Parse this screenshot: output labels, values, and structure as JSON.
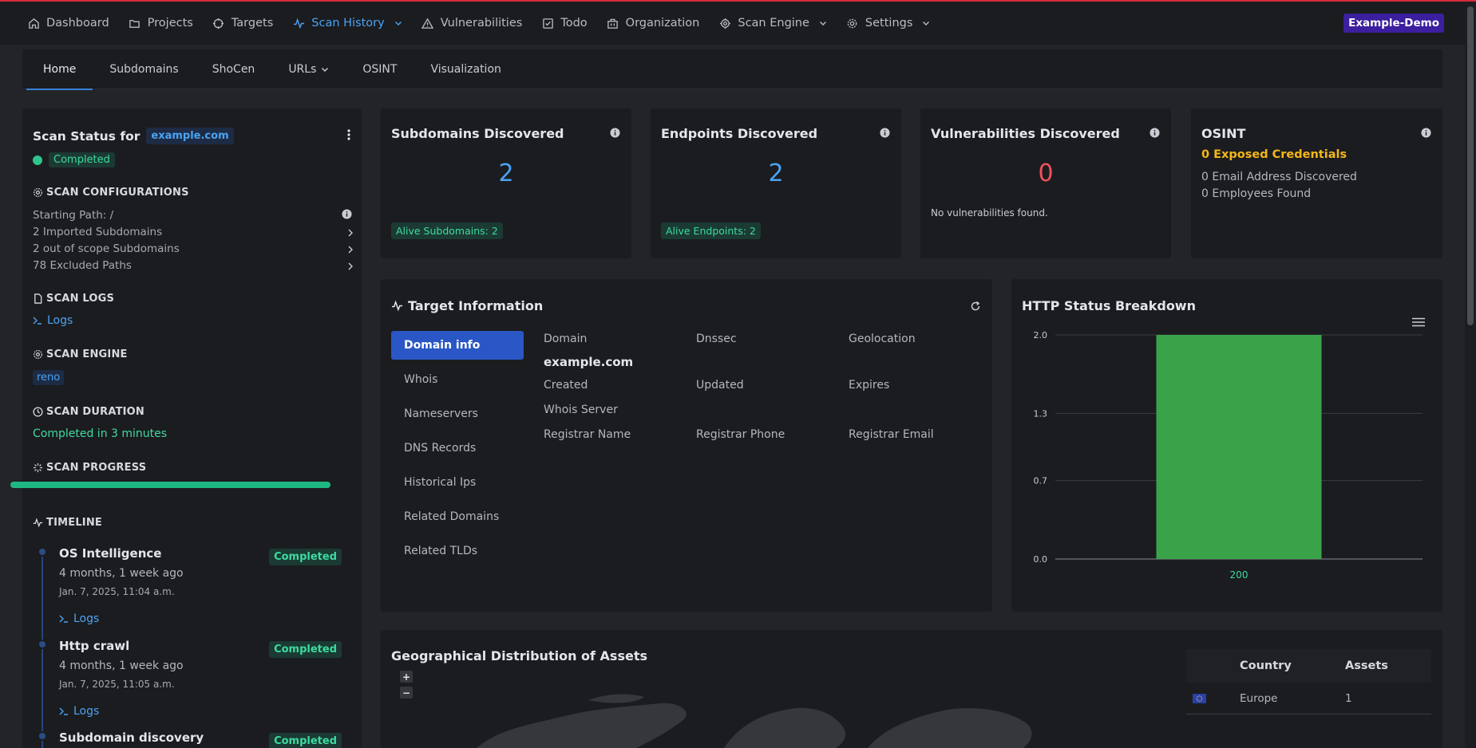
{
  "nav": {
    "items": [
      {
        "label": "Dashboard",
        "icon": "home-icon"
      },
      {
        "label": "Projects",
        "icon": "folder-icon"
      },
      {
        "label": "Targets",
        "icon": "crosshair-icon"
      },
      {
        "label": "Scan History",
        "icon": "activity-icon",
        "active": true,
        "dropdown": true
      },
      {
        "label": "Vulnerabilities",
        "icon": "alert-triangle-icon"
      },
      {
        "label": "Todo",
        "icon": "checkbox-icon"
      },
      {
        "label": "Organization",
        "icon": "building-icon"
      },
      {
        "label": "Scan Engine",
        "icon": "cpu-icon",
        "dropdown": true
      },
      {
        "label": "Settings",
        "icon": "gear-icon",
        "dropdown": true
      }
    ],
    "org_badge": "Example-Demo"
  },
  "tabs": [
    {
      "label": "Home",
      "active": true
    },
    {
      "label": "Subdomains"
    },
    {
      "label": "ShoCen"
    },
    {
      "label": "URLs",
      "dropdown": true
    },
    {
      "label": "OSINT"
    },
    {
      "label": "Visualization"
    }
  ],
  "scan_status": {
    "title": "Scan Status for",
    "domain": "example.com",
    "status": "Completed",
    "config_heading": "SCAN CONFIGURATIONS",
    "starting_path": "Starting Path: /",
    "imported": "2 Imported Subdomains",
    "out_of_scope": "2 out of scope Subdomains",
    "excluded": "78 Excluded Paths",
    "logs_heading": "SCAN LOGS",
    "logs_link": "Logs",
    "engine_heading": "SCAN ENGINE",
    "engine": "reno",
    "duration_heading": "SCAN DURATION",
    "duration": "Completed in 3 minutes",
    "progress_heading": "SCAN PROGRESS",
    "progress_fraction": 1.0,
    "timeline_heading": "TIMELINE",
    "timeline": [
      {
        "title": "OS Intelligence",
        "ago": "4 months, 1 week ago",
        "date": "Jan. 7, 2025, 11:04 a.m.",
        "status": "Completed",
        "logs": "Logs"
      },
      {
        "title": "Http crawl",
        "ago": "4 months, 1 week ago",
        "date": "Jan. 7, 2025, 11:05 a.m.",
        "status": "Completed",
        "logs": "Logs"
      },
      {
        "title": "Subdomain discovery",
        "status": "Completed"
      }
    ]
  },
  "stats": {
    "subdomains": {
      "title": "Subdomains Discovered",
      "value": "2",
      "chip": "Alive Subdomains: 2"
    },
    "endpoints": {
      "title": "Endpoints Discovered",
      "value": "2",
      "chip": "Alive Endpoints: 2"
    },
    "vulns": {
      "title": "Vulnerabilities Discovered",
      "value": "0",
      "note": "No vulnerabilities found."
    },
    "osint": {
      "title": "OSINT",
      "credentials": "0 Exposed Credentials",
      "emails": "0 Email Address Discovered",
      "employees": "0 Employees Found"
    }
  },
  "target_info": {
    "title": "Target Information",
    "tabs": [
      "Domain info",
      "Whois",
      "Nameservers",
      "DNS Records",
      "Historical Ips",
      "Related Domains",
      "Related TLDs"
    ],
    "fields": {
      "domain": "Domain",
      "domain_value": "example.com",
      "dnssec": "Dnssec",
      "geolocation": "Geolocation",
      "created": "Created",
      "updated": "Updated",
      "expires": "Expires",
      "whois_server": "Whois Server",
      "registrar_name": "Registrar Name",
      "registrar_phone": "Registrar Phone",
      "registrar_email": "Registrar Email"
    }
  },
  "http_status": {
    "title": "HTTP Status Breakdown"
  },
  "chart_data": {
    "type": "bar",
    "title": "HTTP Status Breakdown",
    "categories": [
      "200"
    ],
    "values": [
      2
    ],
    "yticks": [
      "2.0",
      "1.3",
      "0.7",
      "0.0"
    ],
    "ylim": [
      0,
      2
    ],
    "bar_color": "#3aa34a",
    "grid": true
  },
  "geo": {
    "title": "Geographical Distribution of Assets",
    "zoom_in": "+",
    "zoom_out": "−",
    "columns": [
      "Country",
      "Assets"
    ],
    "rows": [
      {
        "country": "Europe",
        "assets": "1"
      }
    ]
  }
}
